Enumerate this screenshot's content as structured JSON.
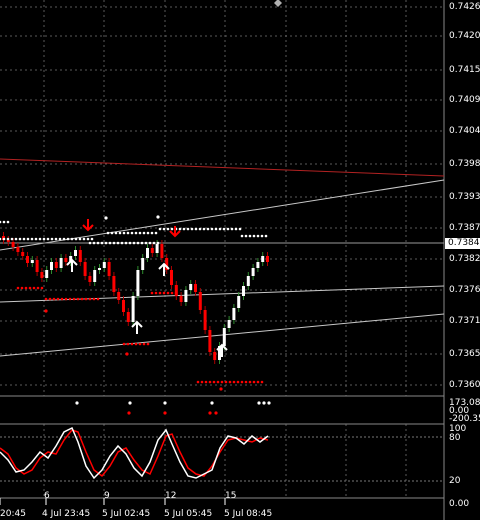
{
  "price_axis": [
    "0.74260",
    "0.74205",
    "0.74150",
    "0.74095",
    "0.74040",
    "0.73985",
    "0.73930",
    "0.73875",
    "0.73820",
    "0.73765",
    "0.73710",
    "0.73655",
    "0.73600"
  ],
  "current_price": "0.73845",
  "time_axis": [
    "20:45",
    "4 Jul 23:45",
    "5 Jul 02:45",
    "5 Jul 05:45",
    "5 Jul 08:45"
  ],
  "sub_time_marks": [
    "6",
    "9",
    "12",
    "15"
  ],
  "indicator1_axis": [
    "173.0821",
    "0.00",
    "-200.3555"
  ],
  "stochastic_axis": [
    "100",
    "80",
    "20",
    "0.00"
  ],
  "colors": {
    "bull": "#ffffff",
    "bear": "#ff0000",
    "grid": "#5a5a5a",
    "trend": "#c8c8c8",
    "resistance": "#b22222",
    "signal": "#ff0000",
    "main": "#ffffff"
  },
  "icons": {
    "buy_arrow": "up-arrow-icon",
    "sell_arrow": "down-arrow-icon",
    "menu": "diamond-icon"
  }
}
